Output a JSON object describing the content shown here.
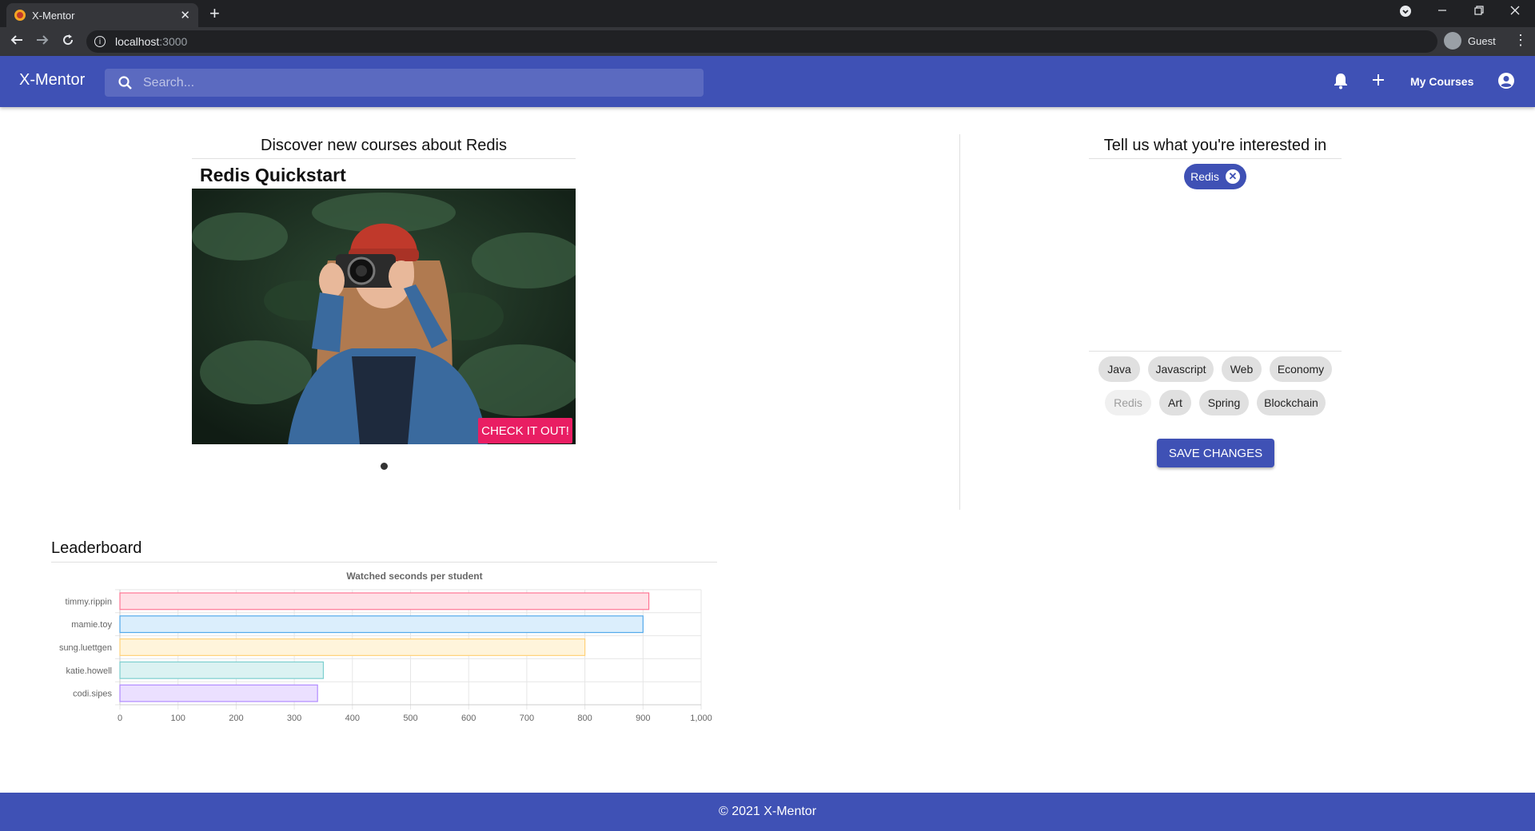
{
  "browser": {
    "tab_title": "X-Mentor",
    "tab_close": "✕",
    "new_tab": "+",
    "url_host": "localhost",
    "url_port": ":3000",
    "profile": "Guest"
  },
  "appbar": {
    "brand": "X-Mentor",
    "search_placeholder": "Search...",
    "my_courses": "My Courses"
  },
  "discover": {
    "title": "Discover new courses about Redis",
    "course_name": "Redis Quickstart",
    "cta": "CHECK IT OUT!"
  },
  "interests": {
    "title": "Tell us what you're interested in",
    "selected": [
      "Redis"
    ],
    "options": [
      {
        "label": "Java",
        "disabled": false
      },
      {
        "label": "Javascript",
        "disabled": false
      },
      {
        "label": "Web",
        "disabled": false
      },
      {
        "label": "Economy",
        "disabled": false
      },
      {
        "label": "Redis",
        "disabled": true
      },
      {
        "label": "Art",
        "disabled": false
      },
      {
        "label": "Spring",
        "disabled": false
      },
      {
        "label": "Blockchain",
        "disabled": false
      }
    ],
    "save_label": "SAVE CHANGES"
  },
  "leaderboard": {
    "title": "Leaderboard"
  },
  "chart_data": {
    "type": "bar",
    "orientation": "horizontal",
    "title": "Watched seconds per student",
    "categories": [
      "timmy.rippin",
      "mamie.toy",
      "sung.luettgen",
      "katie.howell",
      "codi.sipes"
    ],
    "values": [
      910,
      900,
      800,
      350,
      340
    ],
    "xlim": [
      0,
      1000
    ],
    "xticks": [
      "0",
      "100",
      "200",
      "300",
      "400",
      "500",
      "600",
      "700",
      "800",
      "900",
      "1,000"
    ],
    "grid": true,
    "colors": [
      {
        "fill": "#ffe0e6",
        "stroke": "#ff7594"
      },
      {
        "fill": "#dbeefc",
        "stroke": "#52a9eb"
      },
      {
        "fill": "#fff4db",
        "stroke": "#ffd27a"
      },
      {
        "fill": "#dbf2f2",
        "stroke": "#7ccfcf"
      },
      {
        "fill": "#ebe0ff",
        "stroke": "#b08aff"
      }
    ]
  },
  "footer": {
    "text": "© 2021 X-Mentor"
  },
  "colors": {
    "primary": "#3f51b5",
    "accent": "#e91e63"
  }
}
